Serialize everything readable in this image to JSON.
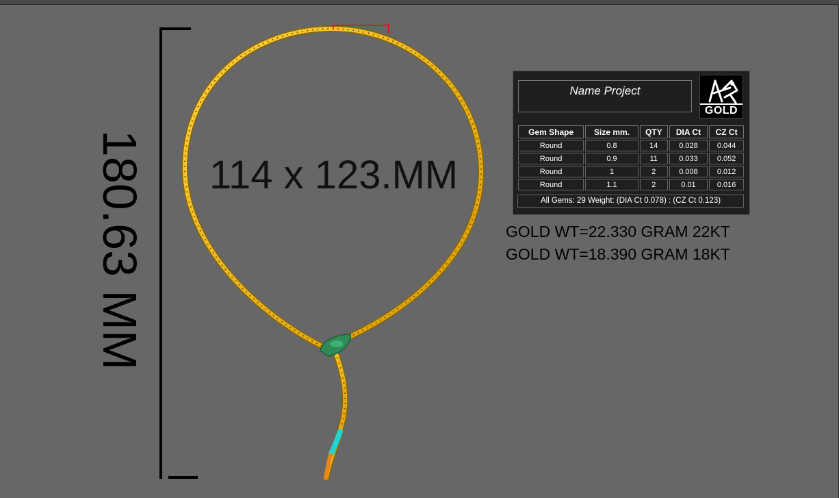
{
  "drawing": {
    "height_dimension": "180.63 MM",
    "size_dimension": "114 x 123.MM"
  },
  "info_panel": {
    "project_name": "Name Project",
    "logo_text": "GOLD",
    "logo_icon": "grasshopper-icon",
    "table": {
      "headers": [
        "Gem Shape",
        "Size mm.",
        "QTY",
        "DIA Ct",
        "CZ Ct"
      ],
      "rows": [
        [
          "Round",
          "0.8",
          "14",
          "0.028",
          "0.044"
        ],
        [
          "Round",
          "0.9",
          "11",
          "0.033",
          "0.052"
        ],
        [
          "Round",
          "1",
          "2",
          "0.008",
          "0.012"
        ],
        [
          "Round",
          "1.1",
          "2",
          "0.01",
          "0.016"
        ]
      ]
    },
    "summary": "All Gems: 29  Weight: (DIA Ct 0.078) : (CZ Ct 0.123)"
  },
  "weights": {
    "gold_22kt": "GOLD WT=22.330 GRAM 22KT",
    "gold_18kt": "GOLD WT=18.390 GRAM 18KT"
  },
  "colors": {
    "background": "#676767",
    "gold": "#f0b400",
    "clasp": "#2e8a57",
    "tip_cyan": "#22d3d3",
    "tip_orange": "#e8851e",
    "marker_red": "#e01010"
  }
}
